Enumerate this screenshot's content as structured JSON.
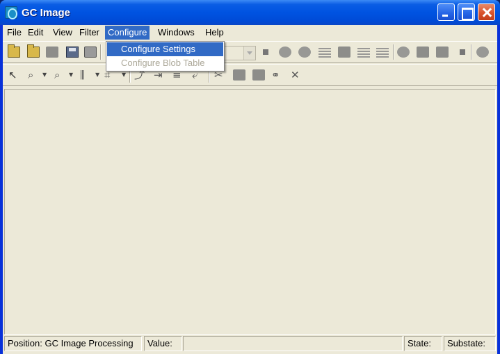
{
  "window": {
    "title": "GC Image"
  },
  "menu": [
    "File",
    "Edit",
    "View",
    "Filter",
    "Configure",
    "Windows",
    "Help"
  ],
  "configure_menu": {
    "items": [
      {
        "label": "Configure Settings",
        "state": "highlighted"
      },
      {
        "label": "Configure Blob Table",
        "state": "disabled"
      }
    ]
  },
  "toolbar_icons": {
    "row1": [
      "open-folder-icon",
      "open-recent-icon",
      "import-icon",
      "save-icon",
      "print-icon",
      "stop-icon",
      "blob-detect-icon",
      "blob-edit-icon",
      "grid-icon",
      "chart-icon",
      "table-icon",
      "spreadsheet-icon",
      "peak-icon",
      "filter-icon",
      "align-icon",
      "point-icon",
      "snapshot-icon"
    ],
    "row2": [
      "pointer-icon",
      "zoom-in-icon",
      "zoom-out-icon",
      "histogram-icon",
      "baseline-icon",
      "insert-icon",
      "move-icon",
      "stack-icon",
      "export-icon",
      "cut-icon",
      "copy-icon",
      "paste-icon",
      "group-icon",
      "delete-icon"
    ]
  },
  "status": {
    "position": "Position: GC Image Processing",
    "value": "Value:",
    "state": "State:",
    "substate": "Substate:"
  }
}
